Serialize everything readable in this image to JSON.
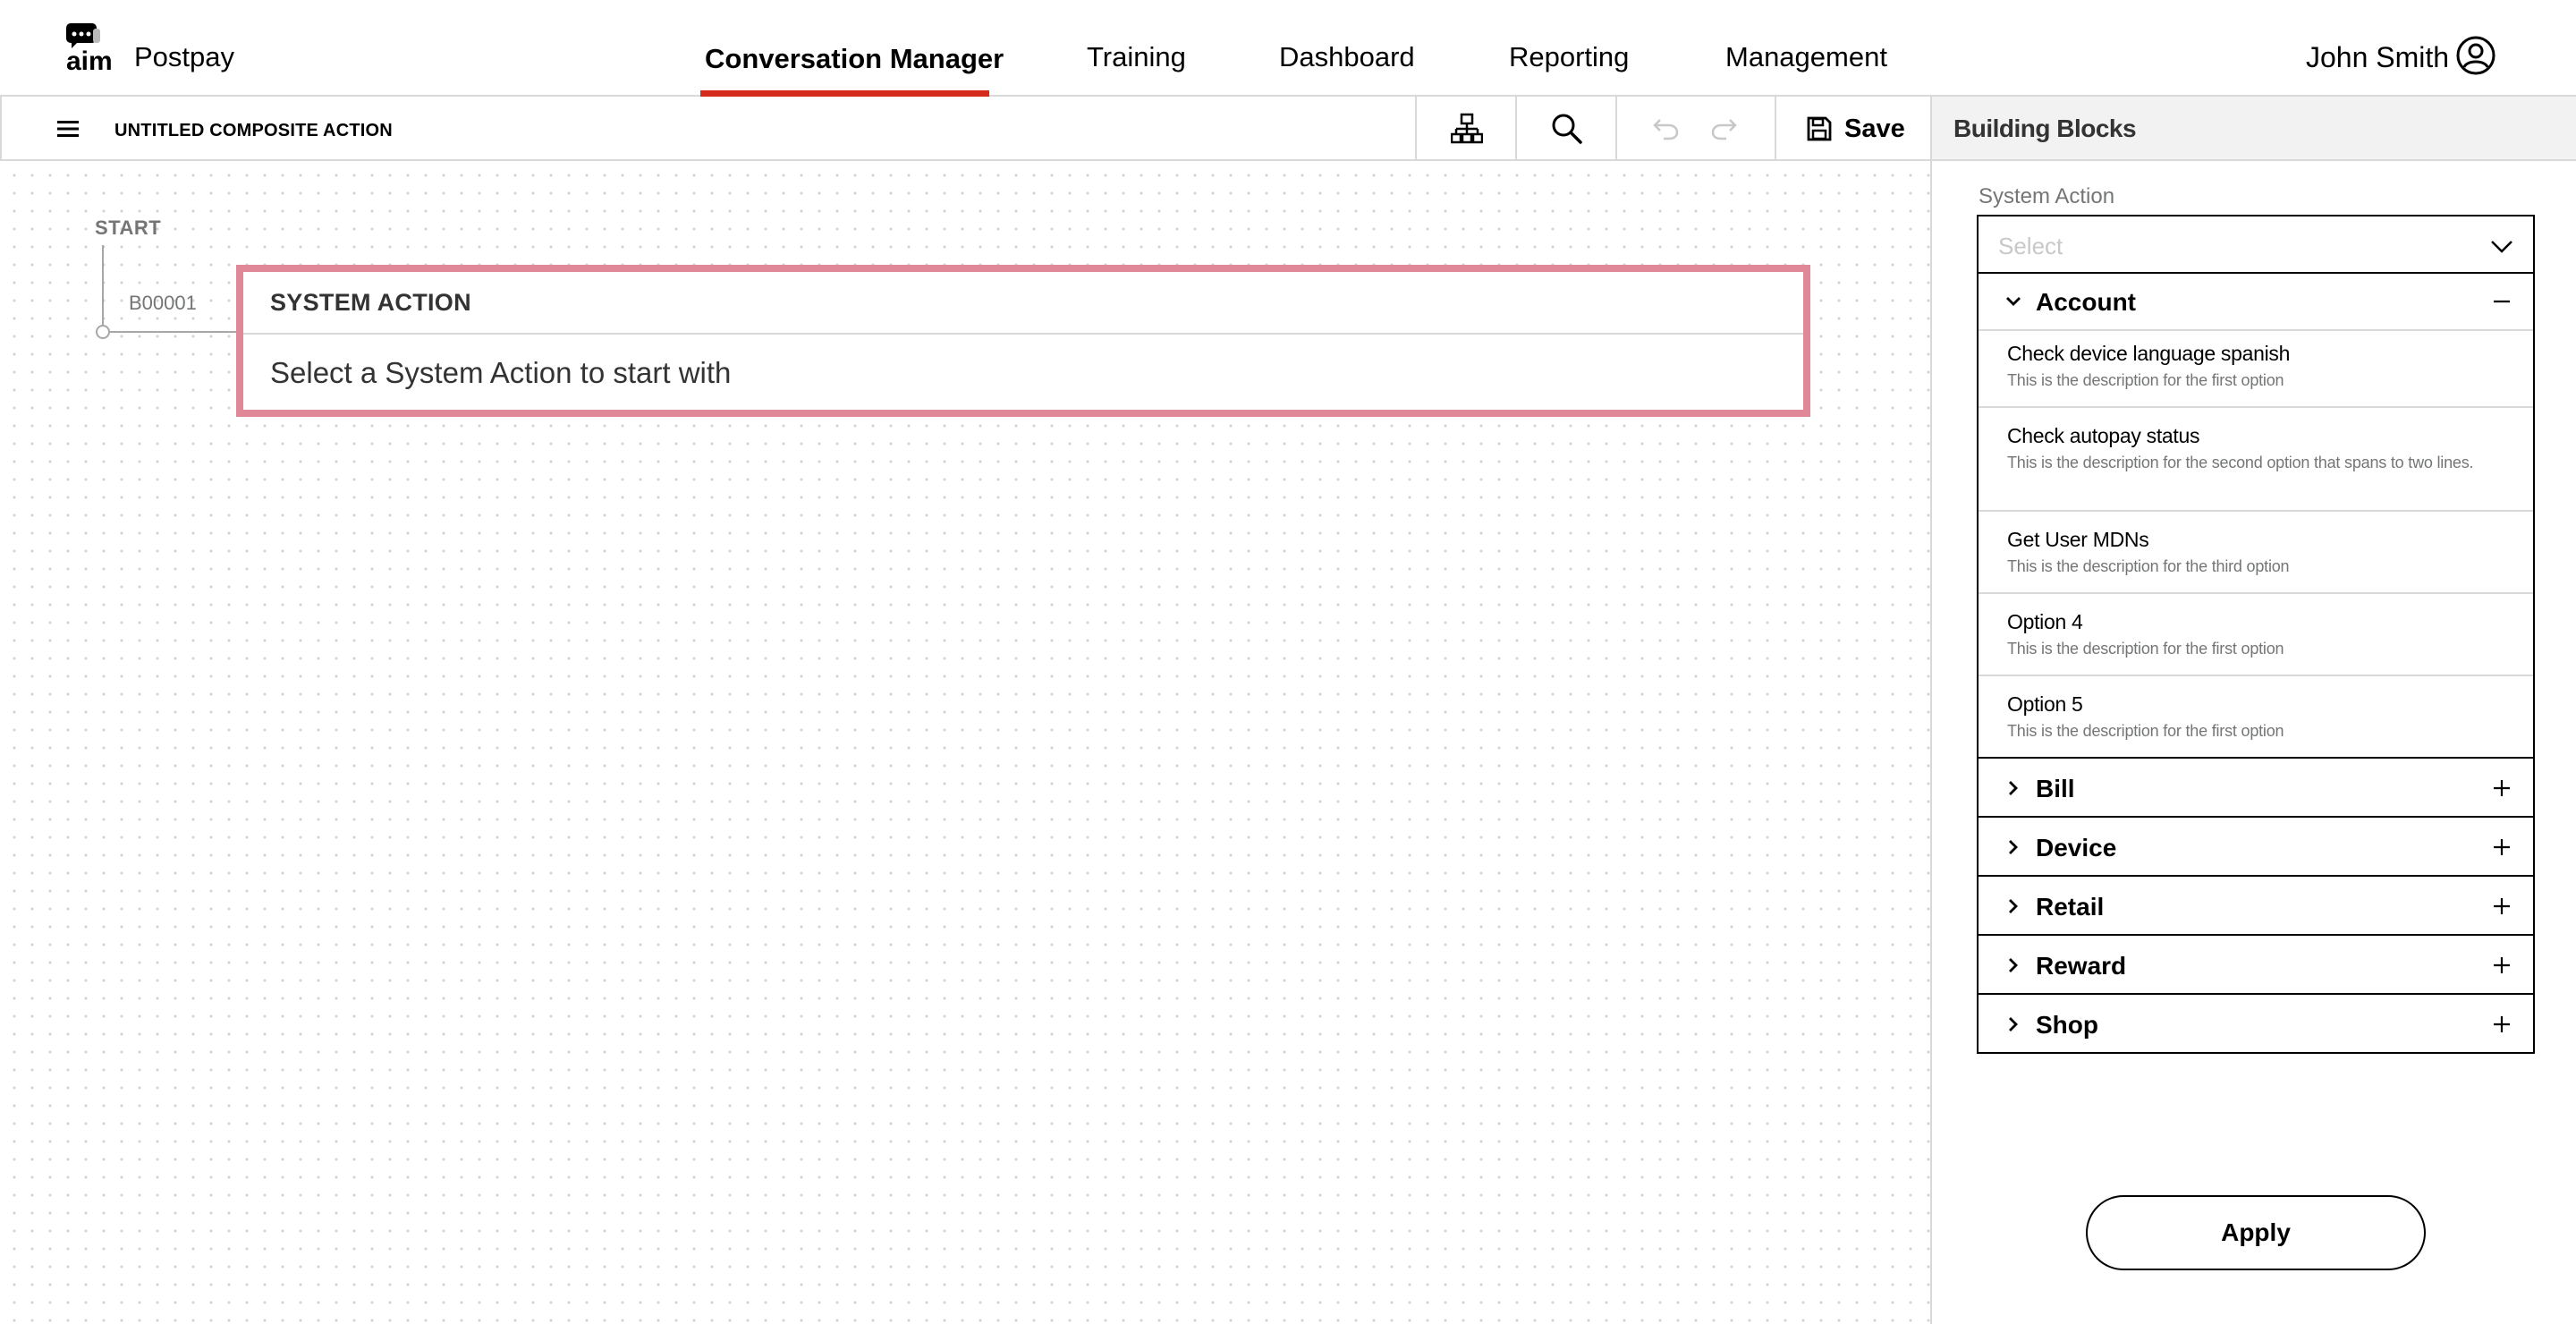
{
  "app": {
    "logo_text": "aim",
    "product": "Postpay"
  },
  "nav": {
    "items": [
      {
        "label": "Conversation Manager",
        "active": true
      },
      {
        "label": "Training"
      },
      {
        "label": "Dashboard"
      },
      {
        "label": "Reporting"
      },
      {
        "label": "Management"
      }
    ],
    "accent_color": "#d52b1e"
  },
  "user": {
    "name": "John Smith",
    "icon": "user-circle-icon"
  },
  "toolbar": {
    "title": "UNTITLED COMPOSITE ACTION",
    "icons": [
      "menu-icon",
      "hierarchy-icon",
      "search-icon",
      "undo-icon",
      "redo-icon",
      "save-icon"
    ],
    "save_label": "Save"
  },
  "canvas": {
    "start_label": "START",
    "node": {
      "id": "B00001",
      "header": "SYSTEM ACTION",
      "body": "Select a System Action to start with",
      "border_color": "#e08898"
    }
  },
  "panel": {
    "title": "Building Blocks",
    "field_label": "System Action",
    "select_placeholder": "Select",
    "categories": [
      {
        "label": "Account",
        "expanded": true,
        "options": [
          {
            "title": "Check device language spanish",
            "desc": "This is the description for the first option"
          },
          {
            "title": "Check autopay status",
            "desc": "This is the description for the second option that spans to two lines."
          },
          {
            "title": "Get User MDNs",
            "desc": "This is the description for the third option"
          },
          {
            "title": "Option 4",
            "desc": "This is the description for the first option"
          },
          {
            "title": "Option 5",
            "desc": "This is the description for the first option"
          }
        ]
      },
      {
        "label": "Bill",
        "expanded": false
      },
      {
        "label": "Device",
        "expanded": false
      },
      {
        "label": "Retail",
        "expanded": false
      },
      {
        "label": "Reward",
        "expanded": false
      },
      {
        "label": "Shop",
        "expanded": false
      }
    ],
    "apply_label": "Apply"
  }
}
